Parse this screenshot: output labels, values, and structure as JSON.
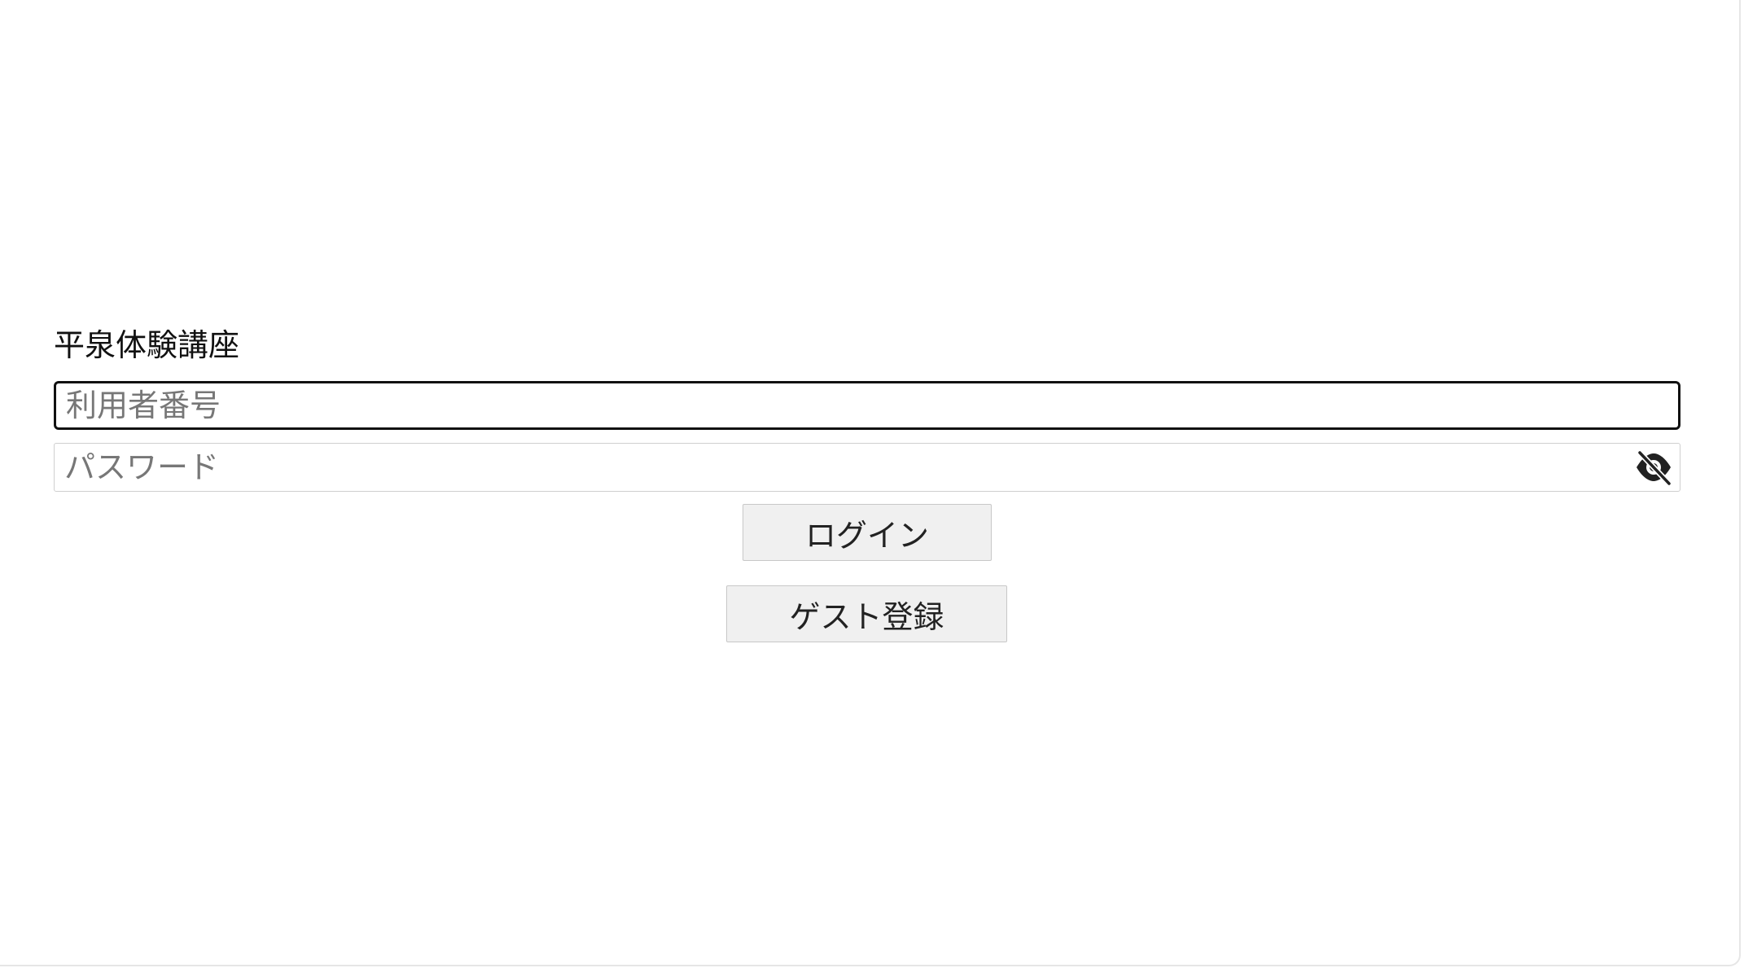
{
  "form": {
    "title": "平泉体験講座",
    "user_id_placeholder": "利用者番号",
    "password_placeholder": "パスワード",
    "password_toggle_icon": "eye-slash-icon"
  },
  "actions": {
    "login_label": "ログイン",
    "guest_register_label": "ゲスト登録"
  }
}
